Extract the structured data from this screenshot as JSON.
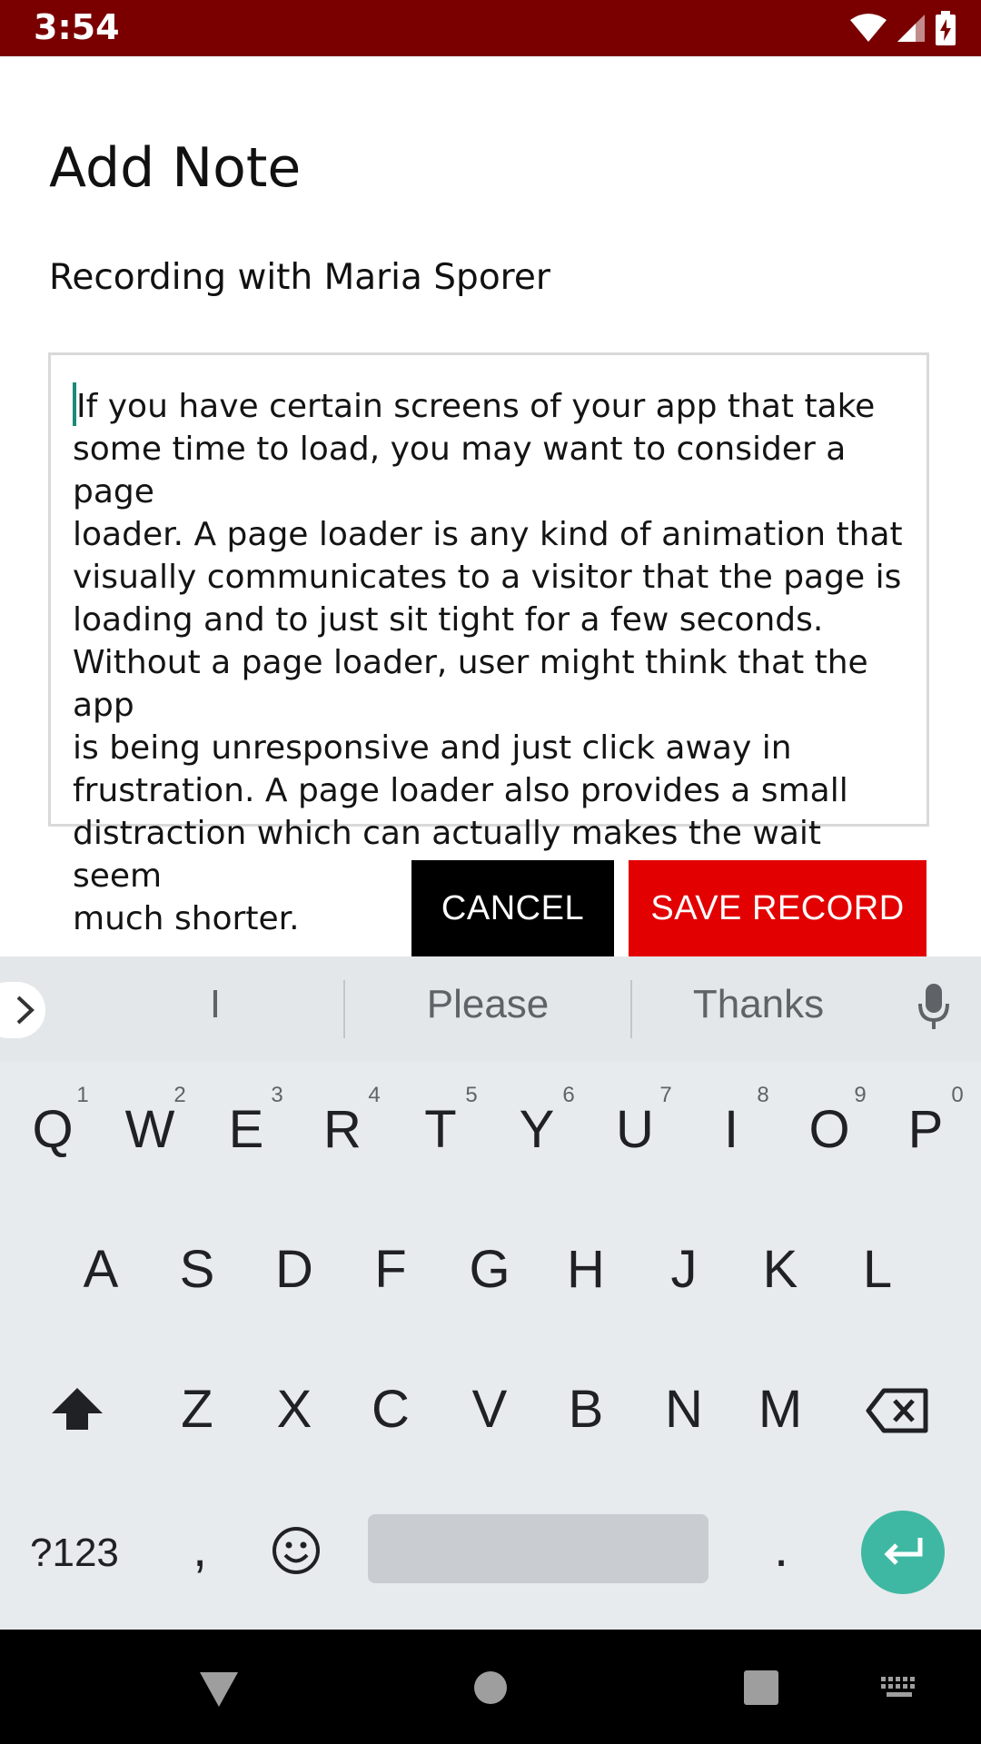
{
  "status_bar": {
    "time": "3:54",
    "icons": [
      "wifi-icon",
      "signal-icon",
      "battery-icon"
    ]
  },
  "dialog": {
    "title": "Add Note",
    "subtitle": "Recording with Maria Sporer",
    "note_text": "If you have certain screens of your app that take\nsome time to load, you may want to consider a page\nloader. A page loader is any kind of animation that\nvisually communicates to a visitor that the page is\nloading and to just sit tight for a few seconds.\nWithout a page loader, user might think that the app\nis being unresponsive and just click away in\nfrustration. A page loader also provides a small\ndistraction which can actually makes the wait seem\nmuch shorter.",
    "cancel_label": "CANCEL",
    "save_label": "SAVE RECORD"
  },
  "keyboard": {
    "suggestions": [
      "I",
      "Please",
      "Thanks"
    ],
    "row1": [
      "Q",
      "W",
      "E",
      "R",
      "T",
      "Y",
      "U",
      "I",
      "O",
      "P"
    ],
    "row1_hints": [
      "1",
      "2",
      "3",
      "4",
      "5",
      "6",
      "7",
      "8",
      "9",
      "0"
    ],
    "row2": [
      "A",
      "S",
      "D",
      "F",
      "G",
      "H",
      "J",
      "K",
      "L"
    ],
    "row3": [
      "Z",
      "X",
      "C",
      "V",
      "B",
      "N",
      "M"
    ],
    "symbols_label": "?123",
    "comma": ",",
    "period": "."
  },
  "colors": {
    "status_bar": "#7a0000",
    "save_button": "#e30000",
    "cancel_button": "#000000",
    "enter_key": "#3fb8a3"
  }
}
